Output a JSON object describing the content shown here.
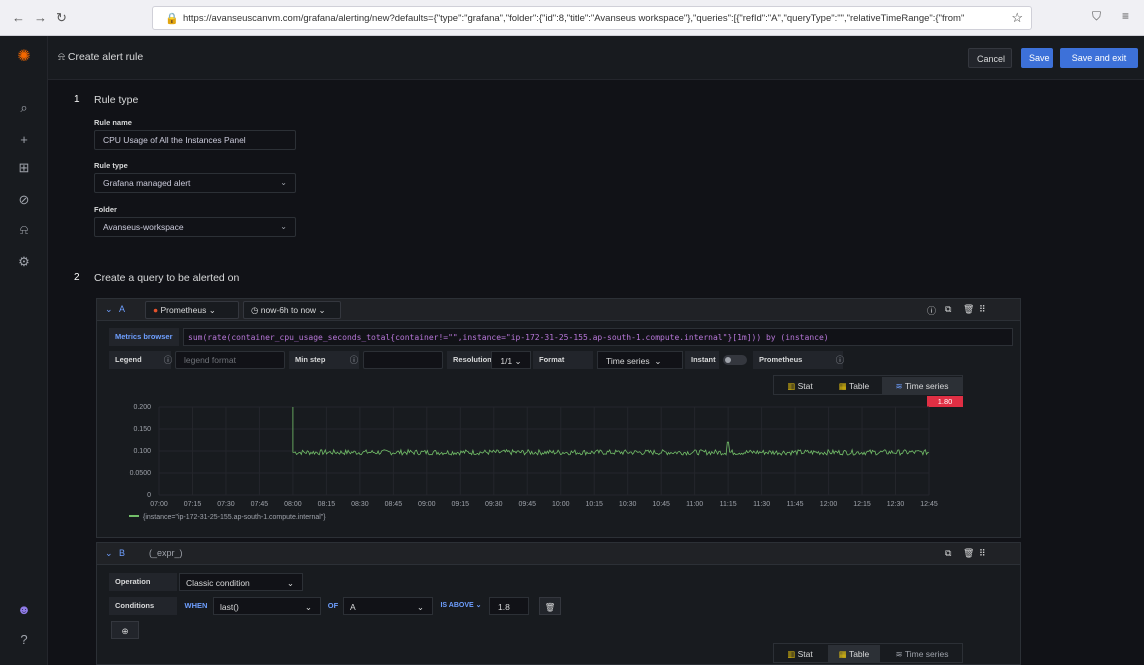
{
  "browser": {
    "url": "https://avanseuscanvm.com/grafana/alerting/new?defaults={\"type\":\"grafana\",\"folder\":{\"id\":8,\"title\":\"Avanseus workspace\"},\"queries\":[{\"refId\":\"A\",\"queryType\":\"\",\"relativeTimeRange\":{\"from\""
  },
  "header": {
    "title": "Create alert rule",
    "cancel": "Cancel",
    "save": "Save",
    "save_exit": "Save and exit"
  },
  "step1": {
    "num": "1",
    "title": "Rule type",
    "rule_name_label": "Rule name",
    "rule_name_value": "CPU Usage of All the Instances Panel",
    "rule_type_label": "Rule type",
    "rule_type_value": "Grafana managed alert",
    "folder_label": "Folder",
    "folder_value": "Avanseus-workspace"
  },
  "step2": {
    "num": "2",
    "title": "Create a query to be alerted on"
  },
  "query_a": {
    "ref": "A",
    "datasource": "Prometheus",
    "time_range": "now-6h to now",
    "metrics_browser": "Metrics browser >",
    "expr": "sum(rate(container_cpu_usage_seconds_total{container!=\"\",instance=\"ip-172-31-25-155.ap-south-1.compute.internal\"}[1m])) by (instance)",
    "legend_label": "Legend",
    "legend_placeholder": "legend format",
    "min_step_label": "Min step",
    "resolution_label": "Resolution",
    "resolution_value": "1/1",
    "format_label": "Format",
    "format_value": "Time series",
    "instant_label": "Instant",
    "prometheus_label": "Prometheus",
    "tabs": [
      "Stat",
      "Table",
      "Time series"
    ],
    "threshold_badge": "1.80"
  },
  "chart_data": {
    "type": "line",
    "y_ticks": [
      "0.200",
      "0.150",
      "0.100",
      "0.0500",
      "0"
    ],
    "ylim": [
      0,
      0.2
    ],
    "x_ticks": [
      "07:00",
      "07:15",
      "07:30",
      "07:45",
      "08:00",
      "08:15",
      "08:30",
      "08:45",
      "09:00",
      "09:15",
      "09:30",
      "09:45",
      "10:00",
      "10:15",
      "10:30",
      "10:45",
      "11:00",
      "11:15",
      "11:30",
      "11:45",
      "12:00",
      "12:15",
      "12:30",
      "12:45"
    ],
    "series": [
      {
        "name": "{instance=\"ip-172-31-25-155.ap-south-1.compute.internal\"}",
        "color": "#73bf69",
        "start": "08:00",
        "spike": 0.2,
        "baseline": 0.097,
        "noise": 0.006,
        "secondary_spike_at": "11:15",
        "secondary_spike": 0.12
      }
    ]
  },
  "query_b": {
    "ref": "B",
    "expr_label": "(_expr_)",
    "operation_label": "Operation",
    "operation_value": "Classic condition",
    "conditions_label": "Conditions",
    "when": "WHEN",
    "func": "last()",
    "of": "OF",
    "of_value": "A",
    "is_above": "IS ABOVE",
    "threshold": "1.8",
    "tabs": [
      "Stat",
      "Table",
      "Time series"
    ]
  },
  "colors": {
    "accent": "#3d71d9",
    "series": "#73bf69",
    "threshold": "#e02f44",
    "brand": "#f46800"
  }
}
